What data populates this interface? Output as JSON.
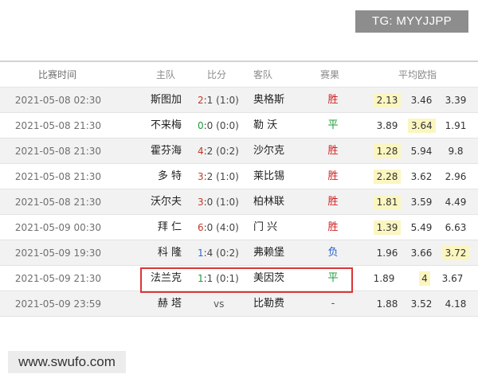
{
  "badge": {
    "text": "TG: MYYJJPP"
  },
  "watermark": {
    "text": "www.swufo.com"
  },
  "table": {
    "headers": [
      "比赛时间",
      "主队",
      "比分",
      "客队",
      "赛果",
      "平均欧指"
    ],
    "rows": [
      {
        "time": "2021-05-08 02:30",
        "home": "斯图加",
        "score": "2:1 (1:0)",
        "away": "奥格斯",
        "result": "胜",
        "odds": [
          "2.13",
          "3.46",
          "3.39"
        ]
      },
      {
        "time": "2021-05-08 21:30",
        "home": "不来梅",
        "score": "0:0 (0:0)",
        "away": "勒 沃",
        "result": "平",
        "odds": [
          "3.89",
          "3.64",
          "1.91"
        ]
      },
      {
        "time": "2021-05-08 21:30",
        "home": "霍芬海",
        "score": "4:2 (0:2)",
        "away": "沙尔克",
        "result": "胜",
        "odds": [
          "1.28",
          "5.94",
          "9.8"
        ]
      },
      {
        "time": "2021-05-08 21:30",
        "home": "多 特",
        "score": "3:2 (1:0)",
        "away": "莱比锡",
        "result": "胜",
        "odds": [
          "2.28",
          "3.62",
          "2.96"
        ]
      },
      {
        "time": "2021-05-08 21:30",
        "home": "沃尔夫",
        "score": "3:0 (1:0)",
        "away": "柏林联",
        "result": "胜",
        "odds": [
          "1.81",
          "3.59",
          "4.49"
        ]
      },
      {
        "time": "2021-05-09 00:30",
        "home": "拜 仁",
        "score": "6:0 (4:0)",
        "away": "门 兴",
        "result": "胜",
        "odds": [
          "1.39",
          "5.49",
          "6.63"
        ]
      },
      {
        "time": "2021-05-09 19:30",
        "home": "科 隆",
        "score": "1:4 (0:2)",
        "away": "弗赖堡",
        "result": "负",
        "odds": [
          "1.96",
          "3.66",
          "3.72"
        ]
      },
      {
        "time": "2021-05-09 21:30",
        "home": "法兰克",
        "score": "1:1 (0:1)",
        "away": "美因茨",
        "result": "平",
        "odds": [
          "1.89",
          "4",
          "3.67"
        ]
      },
      {
        "time": "2021-05-09 23:59",
        "home": "赫 塔",
        "score": "vs",
        "away": "比勒费",
        "result": "-",
        "odds": [
          "1.88",
          "3.52",
          "4.18"
        ]
      }
    ]
  },
  "colors": {
    "win": "#d11f1f",
    "draw": "#1c9b3a",
    "loss": "#2a63c8",
    "highlight": "#fbf6c0",
    "selection": "#d93636"
  }
}
